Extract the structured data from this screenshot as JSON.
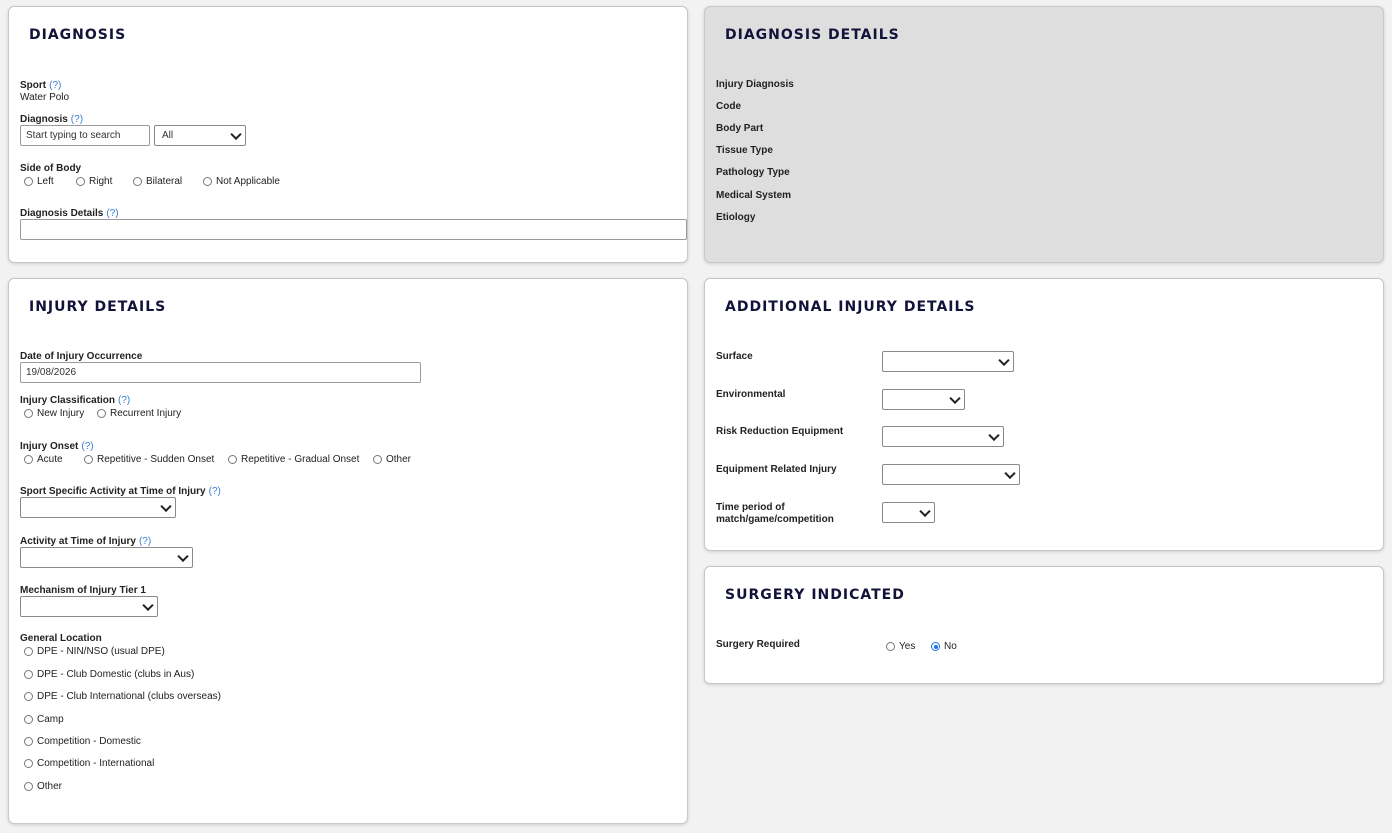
{
  "diagnosis": {
    "title": "DIAGNOSIS",
    "sport_label": "Sport",
    "help": "(?)",
    "sport_value": "Water Polo",
    "diagnosis_label": "Diagnosis",
    "search_placeholder": "Start typing to search",
    "filter_value": "All",
    "side_label": "Side of Body",
    "side_options": [
      "Left",
      "Right",
      "Bilateral",
      "Not Applicable"
    ],
    "details_label": "Diagnosis Details",
    "details_value": ""
  },
  "diagnosis_details": {
    "title": "DIAGNOSIS DETAILS",
    "fields": [
      "Injury Diagnosis",
      "Code",
      "Body Part",
      "Tissue Type",
      "Pathology Type",
      "Medical System",
      "Etiology"
    ]
  },
  "injury": {
    "title": "INJURY DETAILS",
    "date_label": "Date of Injury Occurrence",
    "date_value": "19/08/2026",
    "classification_label": "Injury Classification",
    "classification_options": [
      "New Injury",
      "Recurrent Injury"
    ],
    "onset_label": "Injury Onset",
    "onset_options": [
      "Acute",
      "Repetitive - Sudden Onset",
      "Repetitive - Gradual Onset",
      "Other"
    ],
    "sport_activity_label": "Sport Specific Activity at Time of Injury",
    "activity_label": "Activity at Time of Injury",
    "mechanism_label": "Mechanism of Injury Tier 1",
    "location_label": "General Location",
    "location_options": [
      "DPE - NIN/NSO (usual DPE)",
      "DPE - Club Domestic (clubs in Aus)",
      "DPE - Club International (clubs overseas)",
      "Camp",
      "Competition - Domestic",
      "Competition - International",
      "Other"
    ]
  },
  "additional": {
    "title": "ADDITIONAL INJURY DETAILS",
    "surface_label": "Surface",
    "environmental_label": "Environmental",
    "risk_label": "Risk Reduction Equipment",
    "equipment_label": "Equipment Related Injury",
    "time_label_1": "Time period of",
    "time_label_2": "match/game/competition"
  },
  "surgery": {
    "title": "SURGERY INDICATED",
    "required_label": "Surgery Required",
    "options": [
      "Yes",
      "No"
    ],
    "selected": "No"
  }
}
